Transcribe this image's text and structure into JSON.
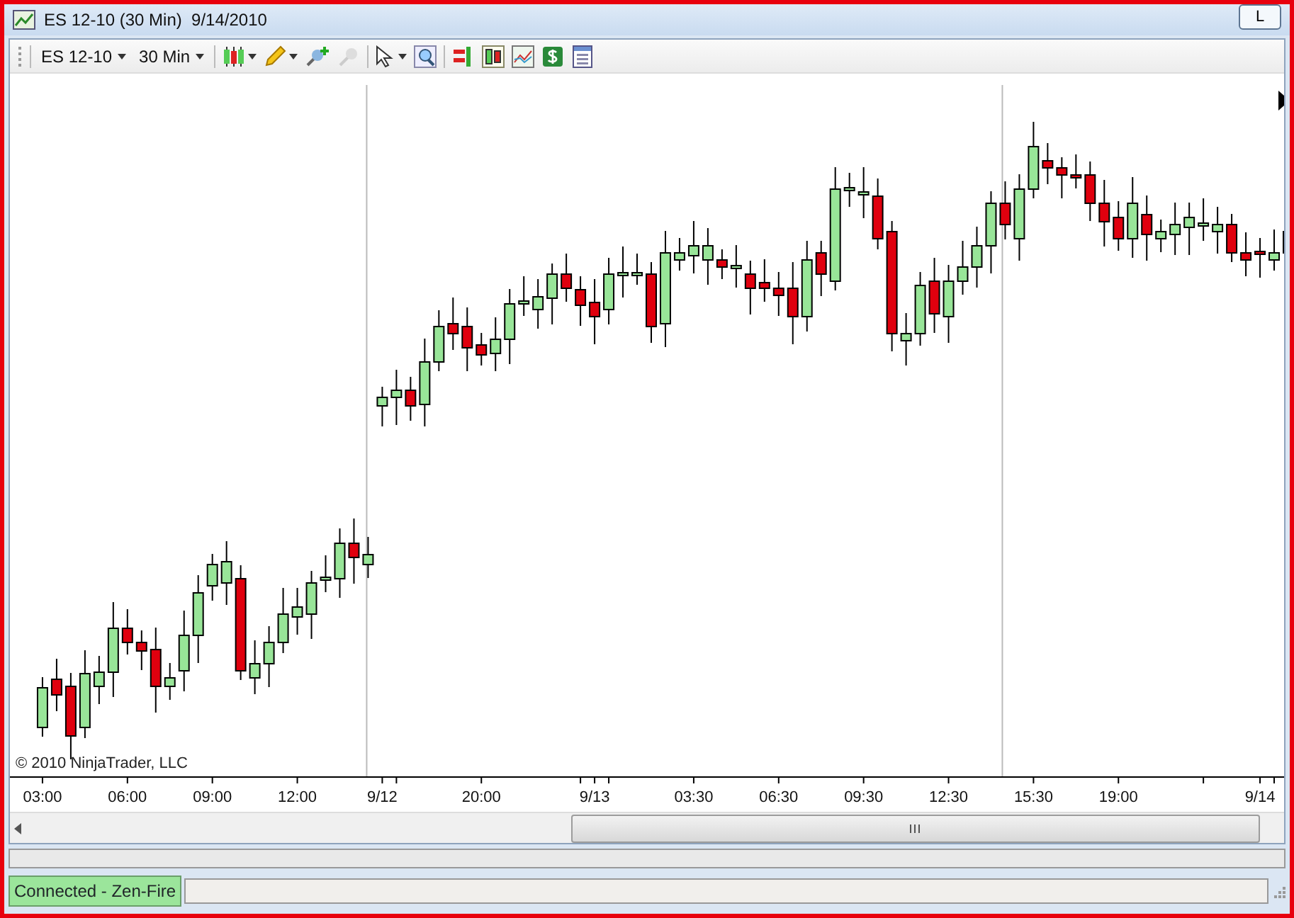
{
  "window": {
    "title": "ES 12-10 (30 Min)  9/14/2010",
    "corner_button": "L"
  },
  "toolbar": {
    "instrument": "ES 12-10",
    "period": "30 Min"
  },
  "chart": {
    "copyright": "© 2010 NinjaTrader, LLC",
    "time_labels": [
      "03:00",
      "06:00",
      "09:00",
      "12:00",
      "9/12",
      "20:00",
      "9/13",
      "03:30",
      "06:30",
      "09:30",
      "12:30",
      "15:30",
      "19:00",
      "9/14"
    ]
  },
  "status_bar": {
    "connection": "Connected - Zen-Fire"
  }
}
